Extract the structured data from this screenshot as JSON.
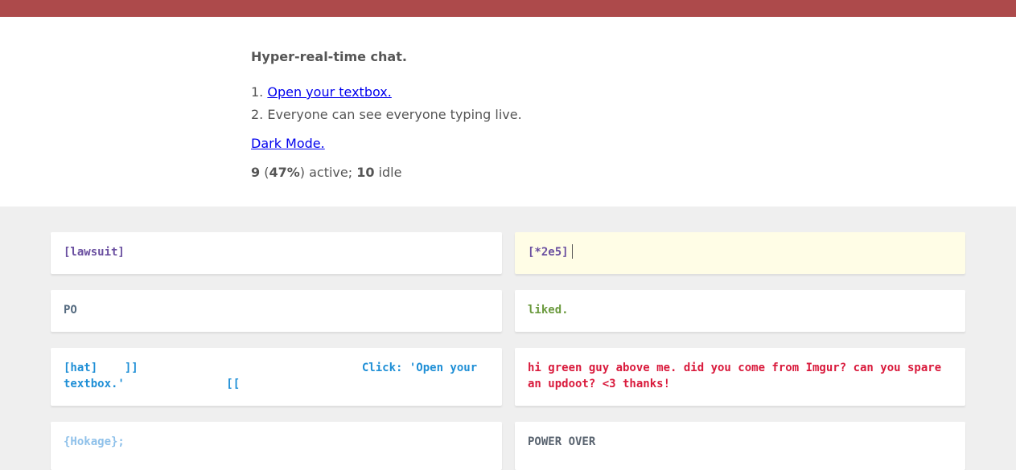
{
  "intro": {
    "headline": "Hyper-real-time chat.",
    "step1_prefix": "1. ",
    "step1_link": "Open your textbox.",
    "step2": "2. Everyone can see everyone typing live.",
    "dark_mode_link": "Dark Mode.",
    "stats": {
      "active_count": "9",
      "paren_open": " (",
      "active_percent": "47%",
      "paren_close_text": ") active; ",
      "idle_count": "10",
      "idle_text": " idle"
    }
  },
  "colors": {
    "topbar": "#ad4a4b",
    "background": "#efefef",
    "active_box": "#fffde6",
    "link": "#0000ee"
  },
  "chat_boxes": [
    {
      "text": "[lawsuit]",
      "color": "#6a4fa0",
      "active": false
    },
    {
      "text": "[*2e5]",
      "color": "#6a4fa0",
      "active": true
    },
    {
      "text": "PO",
      "color": "#556b80",
      "active": false
    },
    {
      "text": "liked.",
      "color": "#6b9a3e",
      "active": false
    },
    {
      "text": "[hat]    ]]                                 Click: 'Open your textbox.'               [[",
      "color": "#1f8fd6",
      "active": false
    },
    {
      "text": "hi green guy above me. did you come from Imgur? can you spare an updoot? <3 thanks!",
      "color": "#d91a3c",
      "active": false
    },
    {
      "text": "{Hokage};",
      "color": "#8fc1ea",
      "active": false
    },
    {
      "text": "POWER OVER",
      "color": "#5a6470",
      "active": false
    }
  ]
}
